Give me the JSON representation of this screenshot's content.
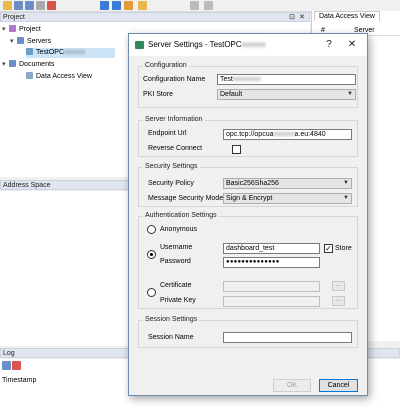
{
  "app": {
    "tree_panel_title": "Project",
    "tree": {
      "project": "Project",
      "servers": "Servers",
      "server_item": "TestOPC",
      "documents": "Documents",
      "data_access_view": "Data Access View"
    },
    "right_tab": "Data Access View",
    "right_col_num": "#",
    "right_col_server": "Server",
    "address_space_title": "Address Space",
    "log_title": "Log",
    "log_col_timestamp": "Timestamp"
  },
  "dialog": {
    "title": "Server Settings - TestOPC",
    "help_glyph": "?",
    "close_glyph": "✕",
    "configuration": {
      "legend": "Configuration",
      "name_label": "Configuration Name",
      "name_value": "Test",
      "pki_label": "PKI Store",
      "pki_value": "Default"
    },
    "server_info": {
      "legend": "Server Information",
      "endpoint_label": "Endpoint Url",
      "endpoint_value_start": "opc.tcp://opcua",
      "endpoint_value_end": "a.eu:4840",
      "reverse_label": "Reverse Connect"
    },
    "security": {
      "legend": "Security Settings",
      "policy_label": "Security Policy",
      "policy_value": "Basic256Sha256",
      "mode_label": "Message Security Mode",
      "mode_value": "Sign & Encrypt"
    },
    "auth": {
      "legend": "Authentication Settings",
      "anonymous_label": "Anonymous",
      "username_label": "Username",
      "username_value": "dashboard_test",
      "store_label": "Store",
      "password_label": "Password",
      "password_value": "●●●●●●●●●●●●●●",
      "certificate_label": "Certificate",
      "private_key_label": "Private Key",
      "browse_glyph": "..."
    },
    "session": {
      "legend": "Session Settings",
      "name_label": "Session Name",
      "name_value": ""
    },
    "ok_label": "OK",
    "cancel_label": "Cancel"
  }
}
